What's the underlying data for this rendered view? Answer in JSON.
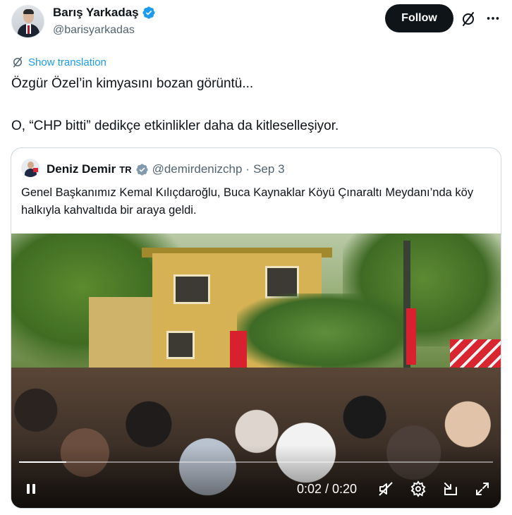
{
  "author": {
    "name": "Barış Yarkadaş",
    "handle": "@barisyarkadas",
    "avatar_icon": "profile-photo-man-suit"
  },
  "actions": {
    "follow_label": "Follow",
    "grok_icon": "grok-icon",
    "more_icon": "more-horizontal-icon"
  },
  "translation": {
    "label": "Show translation"
  },
  "tweet": {
    "line1": "Özgür Özel’in kimyasını bozan görüntü...",
    "line2": "O, “CHP bitti” dedikçe etkinlikler daha da kitleselleşiyor."
  },
  "quote": {
    "name": "Deniz Demir",
    "country_tag": "TR",
    "handle": "@demirdenizchp",
    "separator": "·",
    "date": "Sep 3",
    "text": "Genel Başkanımız Kemal Kılıçdaroğlu, Buca Kaynaklar Köyü Çınaraltı Meydanı’nda köy halkıyla kahvaltıda bir araya geldi."
  },
  "video": {
    "time_display": "0:02 / 0:20",
    "progress_fraction": 0.1,
    "controls": [
      "pause-icon",
      "mute-icon",
      "settings-icon",
      "pip-icon",
      "fullscreen-icon"
    ]
  },
  "colors": {
    "accent": "#1d9bf0",
    "text_primary": "#0f1419",
    "text_secondary": "#536471",
    "follow_bg": "#0f1419",
    "border": "#cfd9de"
  }
}
